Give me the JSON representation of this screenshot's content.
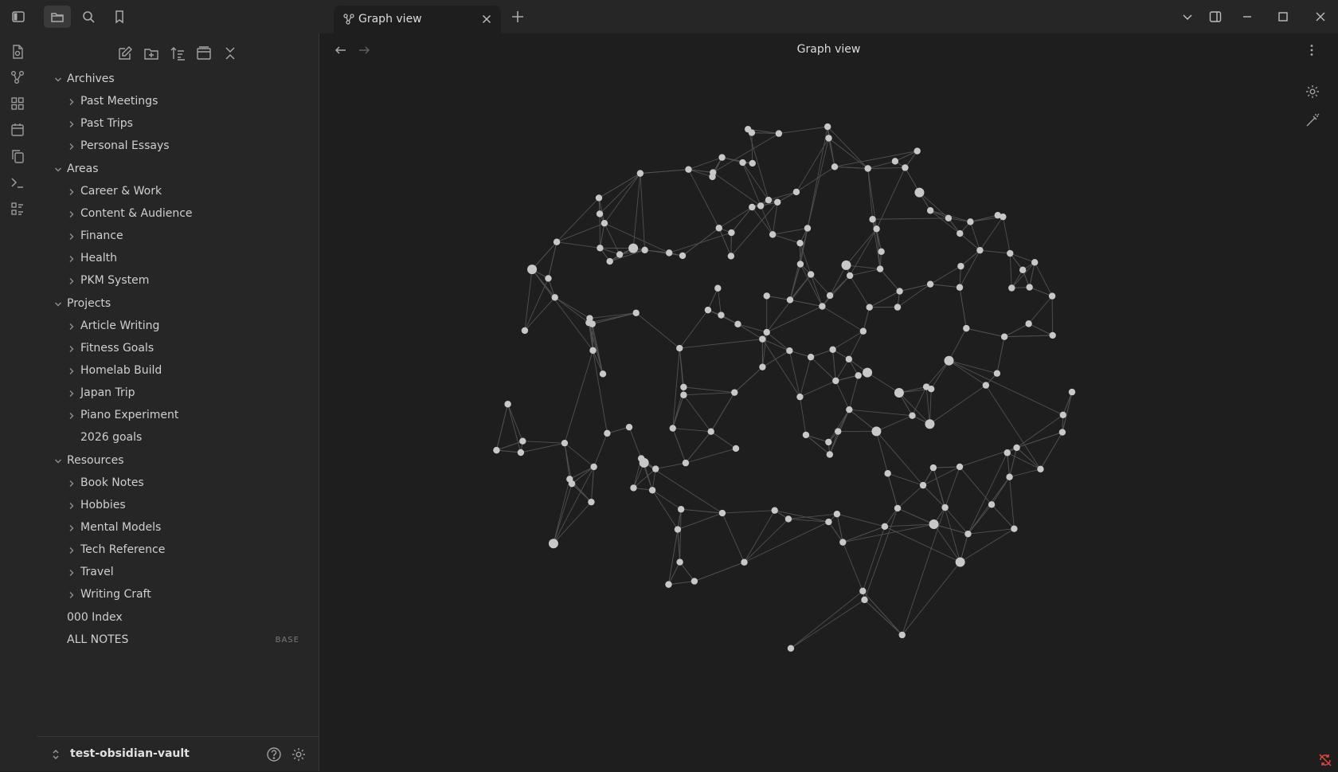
{
  "tab": {
    "title": "Graph view"
  },
  "view": {
    "title": "Graph view"
  },
  "sidebar": {
    "tree": [
      {
        "label": "Archives",
        "level": 0,
        "expanded": true
      },
      {
        "label": "Past Meetings",
        "level": 1
      },
      {
        "label": "Past Trips",
        "level": 1
      },
      {
        "label": "Personal Essays",
        "level": 1
      },
      {
        "label": "Areas",
        "level": 0,
        "expanded": true
      },
      {
        "label": "Career & Work",
        "level": 1
      },
      {
        "label": "Content & Audience",
        "level": 1
      },
      {
        "label": "Finance",
        "level": 1
      },
      {
        "label": "Health",
        "level": 1
      },
      {
        "label": "PKM System",
        "level": 1
      },
      {
        "label": "Projects",
        "level": 0,
        "expanded": true
      },
      {
        "label": "Article Writing",
        "level": 1
      },
      {
        "label": "Fitness Goals",
        "level": 1
      },
      {
        "label": "Homelab Build",
        "level": 1
      },
      {
        "label": "Japan Trip",
        "level": 1
      },
      {
        "label": "Piano Experiment",
        "level": 1
      },
      {
        "label": "2026 goals",
        "level": 1,
        "file": true
      },
      {
        "label": "Resources",
        "level": 0,
        "expanded": true
      },
      {
        "label": "Book Notes",
        "level": 1
      },
      {
        "label": "Hobbies",
        "level": 1
      },
      {
        "label": "Mental Models",
        "level": 1
      },
      {
        "label": "Tech Reference",
        "level": 1
      },
      {
        "label": "Travel",
        "level": 1
      },
      {
        "label": "Writing Craft",
        "level": 1
      },
      {
        "label": "000 Index",
        "level": 0,
        "file": true
      },
      {
        "label": "ALL NOTES",
        "level": 0,
        "file": true,
        "badge": "BASE"
      }
    ]
  },
  "vault": {
    "name": "test-obsidian-vault"
  },
  "colors": {
    "accent": "#7f6df2",
    "node": "#c8c8c8",
    "edge": "#505050",
    "background": "#1e1e1e"
  },
  "icons": [
    "sidebar-toggle-icon",
    "folder-icon",
    "search-icon",
    "bookmark-icon",
    "graph-icon",
    "close-icon",
    "plus-icon",
    "chevron-down-icon",
    "split-icon",
    "minimize-icon",
    "maximize-icon",
    "window-close-icon",
    "settings-icon",
    "magic-wand-icon",
    "more-vertical-icon"
  ]
}
